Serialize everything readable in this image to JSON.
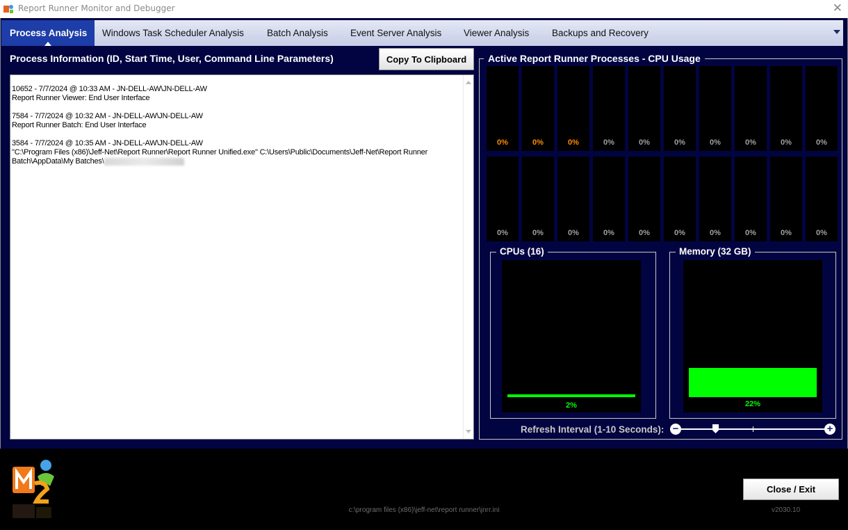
{
  "window": {
    "title": "Report Runner Monitor and Debugger"
  },
  "tabs": [
    {
      "label": "Process Analysis",
      "active": true
    },
    {
      "label": "Windows Task Scheduler Analysis"
    },
    {
      "label": "Batch Analysis"
    },
    {
      "label": "Event Server Analysis"
    },
    {
      "label": "Viewer Analysis"
    },
    {
      "label": "Backups and Recovery"
    }
  ],
  "process_panel": {
    "heading": "Process Information (ID, Start Time, User, Command Line Parameters)",
    "copy_button": "Copy To Clipboard",
    "entries": [
      {
        "line1": "10652 - 7/7/2024 @ 10:33 AM - JN-DELL-AW\\JN-DELL-AW",
        "line2": "Report Runner Viewer: End User Interface"
      },
      {
        "line1": "7584 - 7/7/2024 @ 10:32 AM - JN-DELL-AW\\JN-DELL-AW",
        "line2": "Report Runner Batch: End User Interface"
      },
      {
        "line1": "3584 - 7/7/2024 @ 10:35 AM - JN-DELL-AW\\JN-DELL-AW",
        "line2": "\"C:\\Program Files (x86)\\Jeff-Net\\Report Runner\\Report Runner Unified.exe\" C:\\Users\\Public\\Documents\\Jeff-Net\\Report Runner Batch\\AppData\\My Batches\\"
      }
    ]
  },
  "cpu_panel": {
    "title": "Active Report Runner Processes - CPU Usage",
    "row1": [
      "0%",
      "0%",
      "0%",
      "0%",
      "0%",
      "0%",
      "0%",
      "0%",
      "0%",
      "0%"
    ],
    "row2": [
      "0%",
      "0%",
      "0%",
      "0%",
      "0%",
      "0%",
      "0%",
      "0%",
      "0%",
      "0%"
    ],
    "highlight_color": "#ff8c00",
    "cpus": {
      "label": "CPUs (16)",
      "value": "2%",
      "fraction": 0.02
    },
    "memory": {
      "label": "Memory (32 GB)",
      "value": "22%",
      "fraction": 0.22
    },
    "meter_color": "#00ff00",
    "refresh_label": "Refresh Interval (1-10 Seconds):",
    "refresh_value": 2,
    "refresh_min": 1,
    "refresh_max": 10
  },
  "footer": {
    "ini_path": "c:\\program files (x86)\\jeff-net\\report runner\\jnrr.ini",
    "close_button": "Close / Exit",
    "version": "v2030.10"
  }
}
